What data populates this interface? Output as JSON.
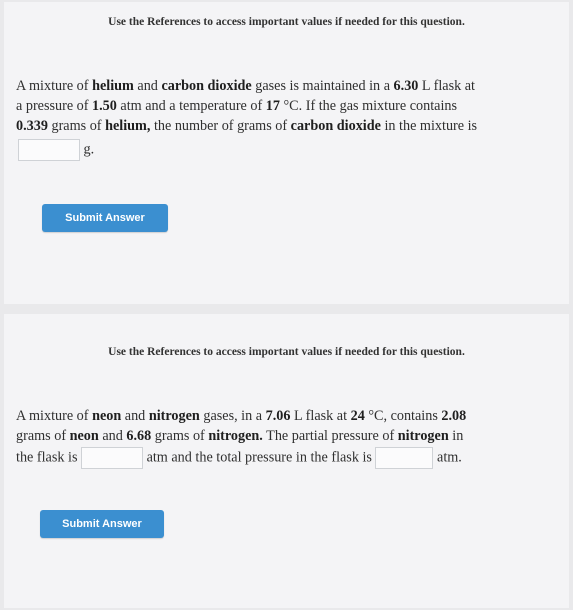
{
  "panel1": {
    "references_note": "Use the References to access important values if needed for this question.",
    "q_part1": "A mixture of ",
    "q_b1": "helium",
    "q_part2": " and ",
    "q_b2": "carbon dioxide",
    "q_part3": " gases is maintained in a ",
    "q_b3": "6.30",
    "q_part4": " L flask at",
    "q_part5": "a pressure of ",
    "q_b4": "1.50",
    "q_part6": " atm and a temperature of ",
    "q_b5": "17",
    "q_part7": " °C. If the gas mixture contains",
    "q_b6": "0.339",
    "q_part8": " grams of ",
    "q_b7": "helium,",
    "q_part9": " the number of grams of ",
    "q_b8": "carbon dioxide",
    "q_part10": " in the mixture is",
    "answer_value": "",
    "answer_unit": "g.",
    "submit_label": "Submit Answer"
  },
  "panel2": {
    "references_note": "Use the References to access important values if needed for this question.",
    "q_part1": "A mixture of ",
    "q_b1": "neon",
    "q_part2": " and ",
    "q_b2": "nitrogen",
    "q_part3": " gases, in a ",
    "q_b3": "7.06",
    "q_part4": " L flask at ",
    "q_b4": "24",
    "q_part5": " °C, contains ",
    "q_b5": "2.08",
    "q_part6": "grams of ",
    "q_b6": "neon",
    "q_part7": " and ",
    "q_b7": "6.68",
    "q_part8": " grams of ",
    "q_b8": "nitrogen.",
    "q_part9": " The partial pressure of ",
    "q_b9": "nitrogen",
    "q_part10": " in",
    "q_part11": "the flask is ",
    "q_part12": " atm and the total pressure in the flask is ",
    "q_part13": " atm.",
    "answer1_value": "",
    "answer2_value": "",
    "submit_label": "Submit Answer"
  }
}
